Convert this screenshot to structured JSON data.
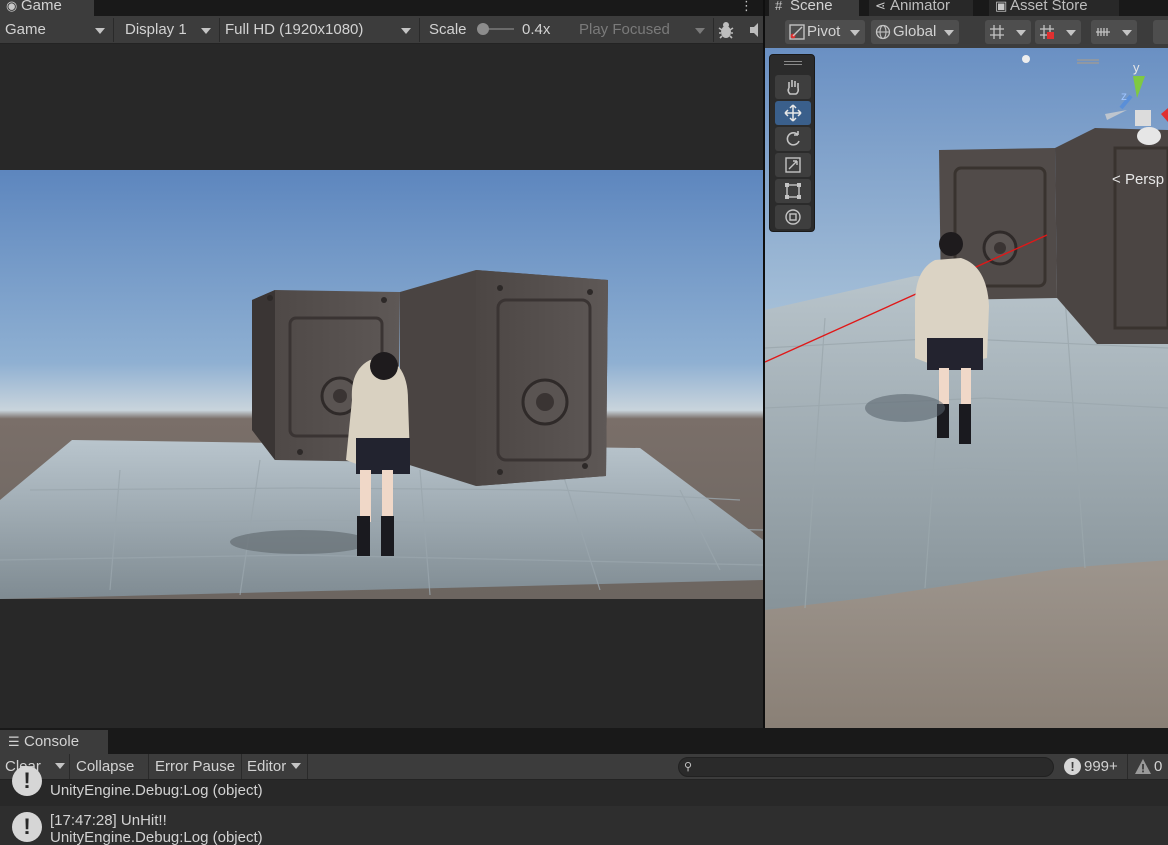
{
  "game": {
    "tab_label": "Game",
    "toolbar": {
      "view_mode": "Game",
      "display": "Display 1",
      "resolution": "Full HD (1920x1080)",
      "scale_label": "Scale",
      "scale_value": "0.4x",
      "play_mode": "Play Focused"
    }
  },
  "scene": {
    "tabs": [
      {
        "label": "Scene"
      },
      {
        "label": "Animator"
      },
      {
        "label": "Asset Store"
      }
    ],
    "toolbar": {
      "pivot": "Pivot",
      "global": "Global"
    },
    "overlay": {
      "axis_y": "y",
      "axis_z": "z",
      "persp_label": "Persp"
    }
  },
  "console": {
    "tab_label": "Console",
    "toolbar": {
      "clear": "Clear",
      "collapse": "Collapse",
      "error_pause": "Error Pause",
      "editor": "Editor",
      "search_placeholder": "",
      "log_count": "999+",
      "warning_count": "0"
    },
    "entries": [
      {
        "message": "",
        "trace": "UnityEngine.Debug:Log (object)"
      },
      {
        "message": "[17:47:28] UnHit!!",
        "trace": "UnityEngine.Debug:Log (object)"
      }
    ]
  },
  "colors": {
    "panel_bg": "#282828",
    "toolbar_bg": "#3c3c3c",
    "active_tool": "#3a5f8b",
    "ray_red": "#e01818"
  }
}
